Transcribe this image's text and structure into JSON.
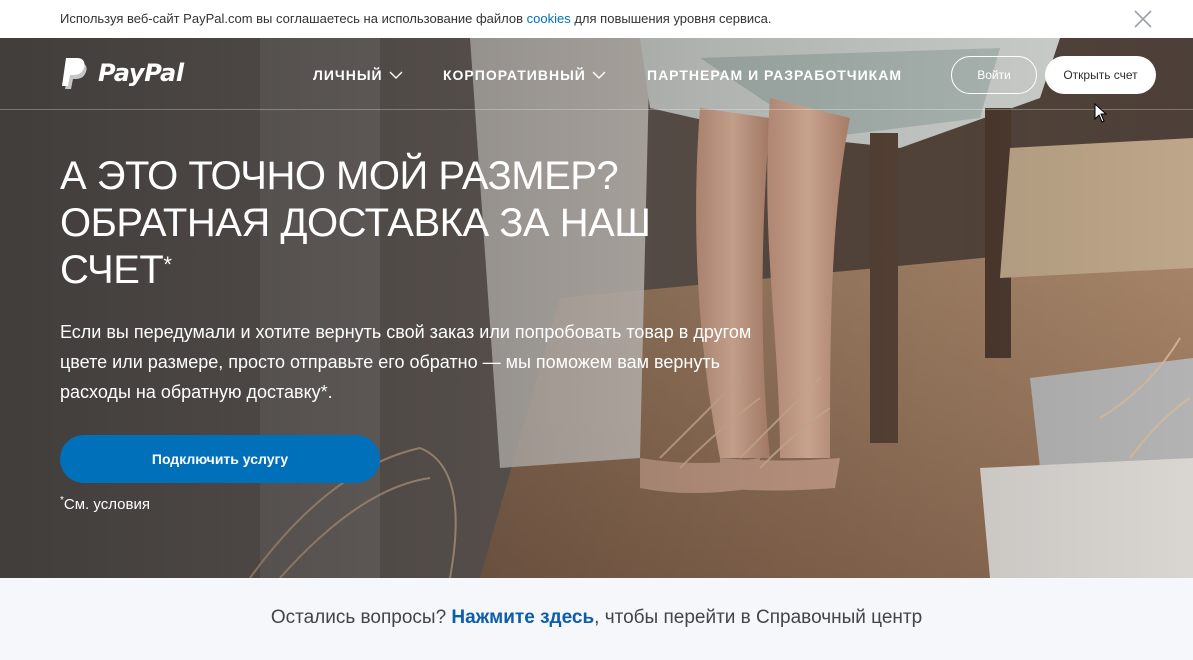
{
  "cookie_bar": {
    "text_before": "Используя веб-сайт PayPal.com вы соглашаетесь на использование файлов ",
    "link": "cookies",
    "text_after": " для повышения уровня сервиса."
  },
  "brand": {
    "name": "PayPal"
  },
  "nav": {
    "personal": "ЛИЧНЫЙ",
    "business": "КОРПОРАТИВНЫЙ",
    "partners": "ПАРТНЕРАМ И РАЗРАБОТЧИКАМ",
    "login": "Войти",
    "signup": "Открыть счет"
  },
  "hero": {
    "headline_line1": "А ЭТО ТОЧНО МОЙ РАЗМЕР?",
    "headline_line2": "ОБРАТНАЯ ДОСТАВКА ЗА НАШ",
    "headline_line3": "СЧЕТ",
    "headline_mark": "*",
    "subtext": "Если вы передумали и хотите вернуть свой заказ или попробовать товар в другом цвете или размере, просто отправьте его обратно — мы поможем вам вернуть расходы на обратную доставку*.",
    "cta": "Подключить услугу",
    "terms_mark": "*",
    "terms": "См. условия"
  },
  "help": {
    "before": "Остались вопросы? ",
    "link": "Нажмите здесь",
    "after": ", чтобы перейти в Справочный центр"
  },
  "colors": {
    "accent": "#0070ba",
    "help_link": "#0c5ea8",
    "help_bg": "#f5f7fa"
  }
}
